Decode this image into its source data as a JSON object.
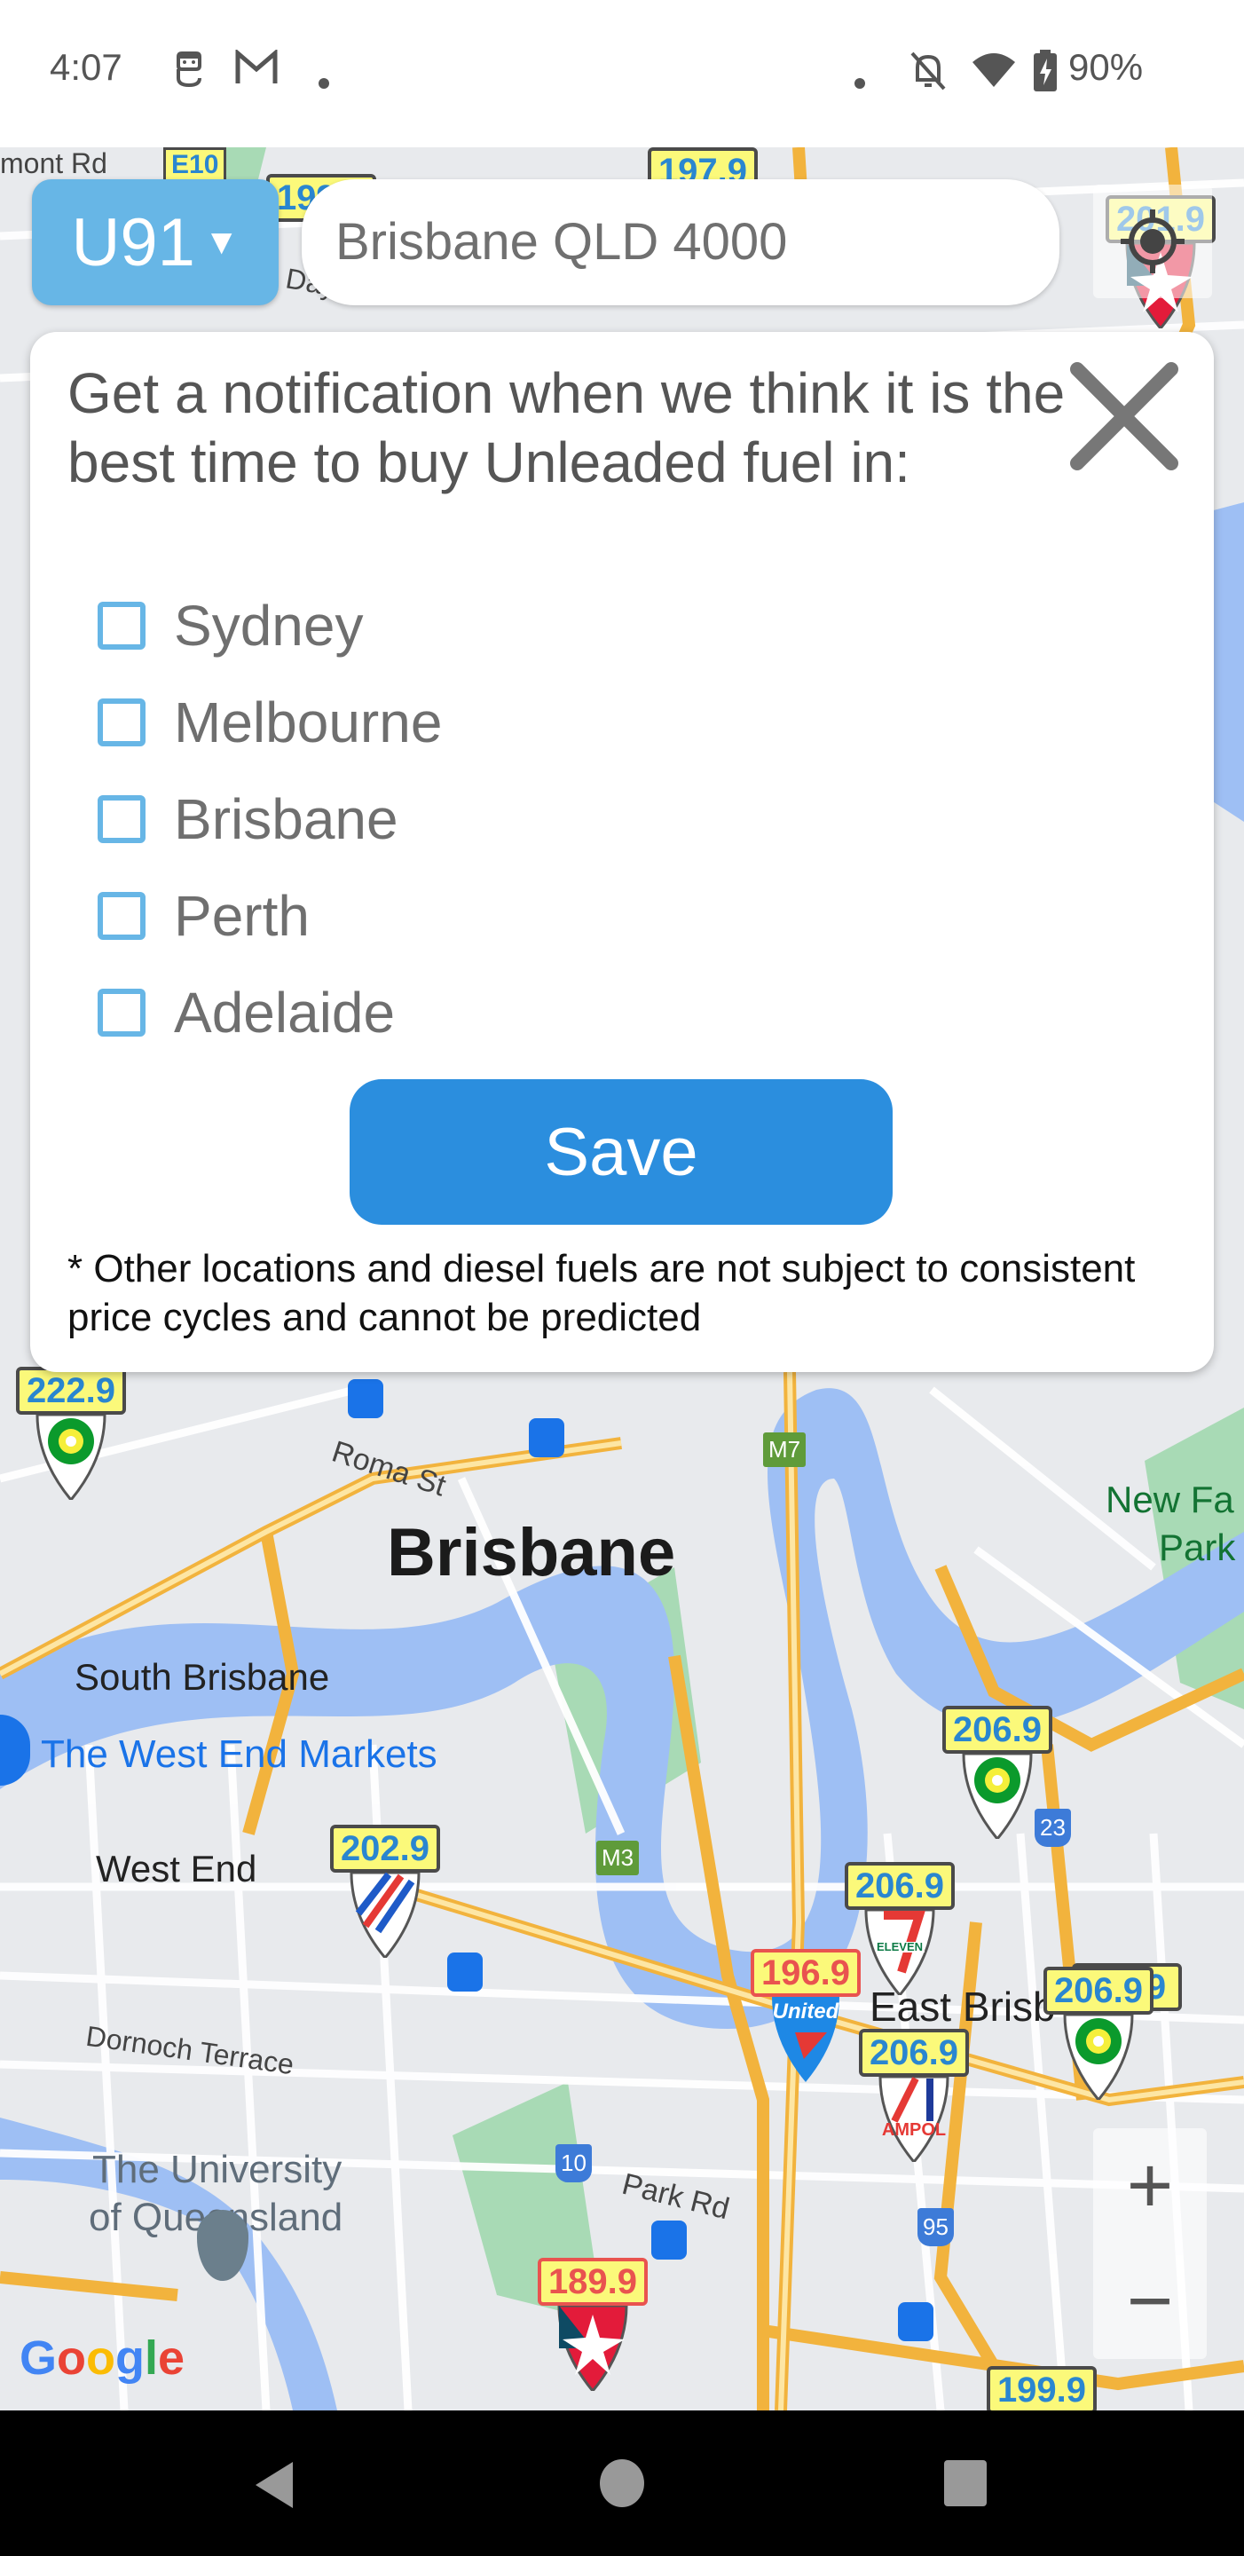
{
  "status_bar": {
    "time": "4:07",
    "left_icons": [
      "app-notification-icon",
      "gmail-icon",
      "dot-icon"
    ],
    "right_icons": [
      "dot-icon",
      "notifications-off-icon",
      "wifi-icon",
      "battery-charging-icon"
    ],
    "battery": "90%"
  },
  "toolbar": {
    "fuel_type": "U91",
    "search_value": "Brisbane QLD 4000",
    "search_placeholder": "Brisbane QLD 4000",
    "locate_icon": "my-location-icon"
  },
  "modal": {
    "title": "Get a notification when we think it is the best time to buy Unleaded fuel in:",
    "close_icon": "close-icon",
    "cities": [
      {
        "label": "Sydney",
        "checked": true
      },
      {
        "label": "Melbourne",
        "checked": false
      },
      {
        "label": "Brisbane",
        "checked": true
      },
      {
        "label": "Perth",
        "checked": false
      },
      {
        "label": "Adelaide",
        "checked": false
      }
    ],
    "save_label": "Save",
    "disclaimer": "* Other locations and diesel fuels are not subject to consistent price cycles and cannot be predicted",
    "accent_color": "#67b6e6",
    "button_color": "#2b8ede"
  },
  "map": {
    "labels": {
      "city": "Brisbane",
      "south_brisbane": "South Brisbane",
      "west_end_markets": "The West End Markets",
      "west_end": "West End",
      "roma_st": "Roma St",
      "new_farm_park_1": "New Fa",
      "new_farm_park_2": "Park",
      "east_brisbane": "East Brisb",
      "dornoch": "Dornoch Terrace",
      "uq_1": "The University",
      "uq_2": "of Queensland",
      "park_rd": "Park Rd",
      "dayboro": "Day",
      "road_top": "mont Rd",
      "google": "Google"
    },
    "road_shields": [
      "M7",
      "M3",
      "23",
      "10",
      "95",
      "E10"
    ],
    "stations": [
      {
        "price": "222.9",
        "brand": "BP",
        "lowest": false
      },
      {
        "price": "206.9",
        "brand": "BP",
        "lowest": false
      },
      {
        "price": "202.9",
        "brand": "Liberty",
        "lowest": false
      },
      {
        "price": "206.9",
        "brand": "7-Eleven",
        "lowest": false
      },
      {
        "price": "196.9",
        "brand": "United",
        "lowest": true
      },
      {
        "price": "206.9",
        "brand": "Ampol",
        "lowest": false
      },
      {
        "price": "206.9",
        "brand": "BP",
        "lowest": false
      },
      {
        "price": "206.9",
        "brand": "7-Eleven",
        "lowest": false
      },
      {
        "price": "189.9",
        "brand": "Caltex",
        "lowest": true
      },
      {
        "price": "199.9",
        "brand": "Unknown",
        "lowest": false
      },
      {
        "price": "197.9",
        "brand": "Caltex",
        "lowest": false
      },
      {
        "price": "201.9",
        "brand": "Caltex",
        "lowest": false
      },
      {
        "price": "199.9",
        "brand": "Unknown",
        "lowest": false
      }
    ],
    "zoom_in": "+",
    "zoom_out": "−"
  },
  "nav_bar": {
    "back": "back-icon",
    "home": "home-icon",
    "recents": "recents-icon"
  }
}
